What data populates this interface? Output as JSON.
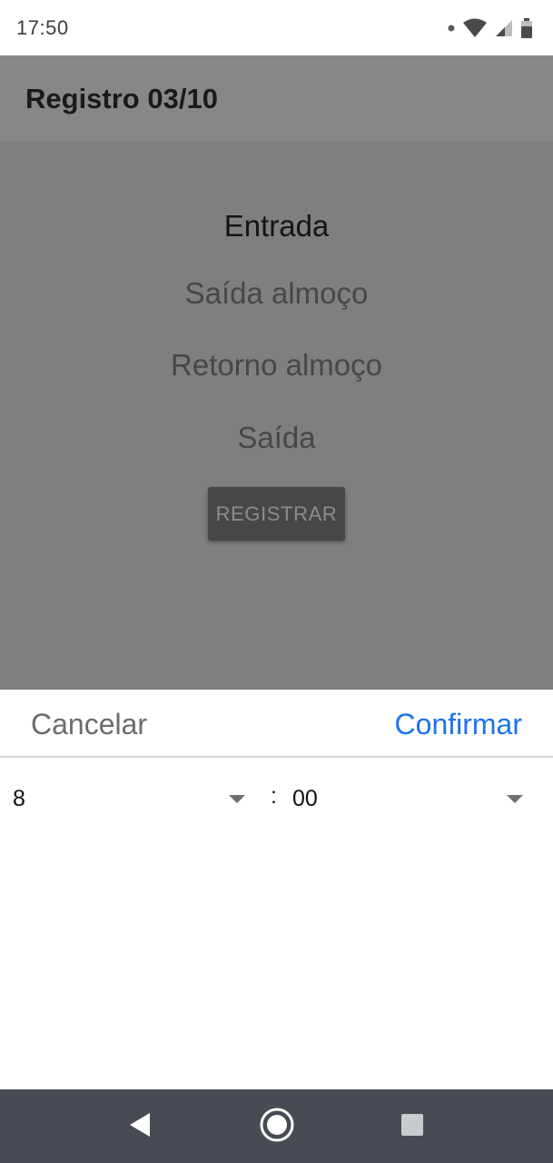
{
  "status_bar": {
    "time": "17:50",
    "icons": [
      "notification-dot-icon",
      "wifi-icon",
      "signal-icon",
      "battery-icon"
    ]
  },
  "app_bar": {
    "title": "Registro 03/10"
  },
  "options": [
    {
      "label": "Entrada",
      "selected": true
    },
    {
      "label": "Saída almoço",
      "selected": false
    },
    {
      "label": "Retorno almoço",
      "selected": false
    },
    {
      "label": "Saída",
      "selected": false
    }
  ],
  "register_button": {
    "label": "REGISTRAR"
  },
  "time_picker": {
    "cancel_label": "Cancelar",
    "confirm_label": "Confirmar",
    "hour": "8",
    "separator": ":",
    "minute": "00"
  },
  "colors": {
    "accent": "#1e73e8",
    "overlay": "#7f7f7f",
    "nav_bar": "#474c54"
  },
  "nav_bar": {
    "icons": [
      "back-icon",
      "home-icon",
      "recents-icon"
    ]
  }
}
